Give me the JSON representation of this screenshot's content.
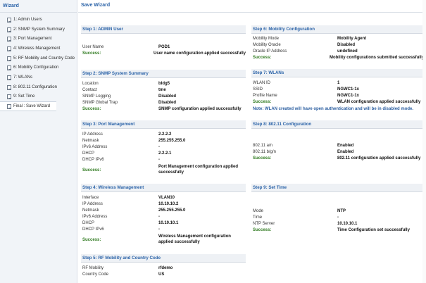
{
  "sidebar": {
    "title": "Wizard",
    "items": [
      {
        "label": "1: Admin Users"
      },
      {
        "label": "2: SNMP System Summary"
      },
      {
        "label": "3: Port Management"
      },
      {
        "label": "4: Wireless Management"
      },
      {
        "label": "5: RF Mobility and Country Code"
      },
      {
        "label": "6: Mobility Configuration"
      },
      {
        "label": "7: WLANs"
      },
      {
        "label": "8: 802.11 Configuration"
      },
      {
        "label": "9: Set Time"
      },
      {
        "label": "Final : Save Wizard"
      }
    ]
  },
  "main": {
    "title": "Save Wizard",
    "step1": {
      "header": "Step 1: ADMIN User",
      "rows": [
        {
          "label": "User Name",
          "value": "POD1"
        },
        {
          "label": "Success:",
          "value": "User name configuration applied successfully"
        }
      ]
    },
    "step2": {
      "header": "Step 2: SNMP System Summary",
      "rows": [
        {
          "label": "Location",
          "value": "bldg5"
        },
        {
          "label": "Contact",
          "value": "tme"
        },
        {
          "label": "SNMP Logging",
          "value": "Disabled"
        },
        {
          "label": "SNMP Global Trap",
          "value": "Disabled"
        },
        {
          "label": "Success:",
          "value": "SNMP configuration applied successfully"
        }
      ]
    },
    "step3": {
      "header": "Step 3: Port Management",
      "rows": [
        {
          "label": "IP Address",
          "value": "2.2.2.2"
        },
        {
          "label": "Netmask",
          "value": "255.255.255.0"
        },
        {
          "label": "IPv6 Address",
          "value": "-"
        },
        {
          "label": "DHCP",
          "value": "2.2.2.1"
        },
        {
          "label": "DHCP IPv6",
          "value": "-"
        },
        {
          "label": "Success:",
          "value": "Port Management configuration applied successfully"
        }
      ]
    },
    "step4": {
      "header": "Step 4: Wireless Management",
      "rows": [
        {
          "label": "Interface",
          "value": "VLAN10"
        },
        {
          "label": "IP Address",
          "value": "10.10.10.2"
        },
        {
          "label": "Netmask",
          "value": "255.255.255.0"
        },
        {
          "label": "IPv6 Address",
          "value": "-"
        },
        {
          "label": "DHCP",
          "value": "10.10.10.1"
        },
        {
          "label": "DHCP IPv6",
          "value": "-"
        },
        {
          "label": "Success:",
          "value": "Wireless Management configuration applied successfully"
        }
      ]
    },
    "step5": {
      "header": "Step 5: RF Mobility and Country Code",
      "rows": [
        {
          "label": "RF Mobility",
          "value": "rfdemo"
        },
        {
          "label": "Country Code",
          "value": "US"
        }
      ]
    },
    "step6": {
      "header": "Step 6: Mobility Configuration",
      "rows": [
        {
          "label": "Mobility Mode",
          "value": "Mobility Agent"
        },
        {
          "label": "Mobility Oracle",
          "value": "Disabled"
        },
        {
          "label": "Oracle IP Address",
          "value": "undefined"
        },
        {
          "label": "Success:",
          "value": "Mobility configurations submitted successfully"
        }
      ]
    },
    "step7": {
      "header": "Step 7: WLANs",
      "rows": [
        {
          "label": "WLAN ID",
          "value": "1"
        },
        {
          "label": "SSID",
          "value": "NGWC1-1x"
        },
        {
          "label": "Profile Name",
          "value": "NGWC1-1x"
        },
        {
          "label": "Success:",
          "value": "WLAN configuration applied successfully"
        }
      ],
      "note": "Note: WLAN created will have open authentication and will be in disabled mode."
    },
    "step8": {
      "header": "Step 8: 802.11 Configuration",
      "rows": [
        {
          "label": "802.11 a/n",
          "value": "Enabled"
        },
        {
          "label": "802.11 b/g/n",
          "value": "Enabled"
        },
        {
          "label": "Success:",
          "value": "802.11 configuration applied successfully"
        }
      ]
    },
    "step9": {
      "header": "Step 9: Set Time",
      "rows": [
        {
          "label": "Mode",
          "value": "NTP"
        },
        {
          "label": "Time",
          "value": "-"
        },
        {
          "label": "NTP Server",
          "value": "10.10.10.1"
        },
        {
          "label": "Success:",
          "value": "Time Configuration set successfully"
        }
      ]
    }
  }
}
